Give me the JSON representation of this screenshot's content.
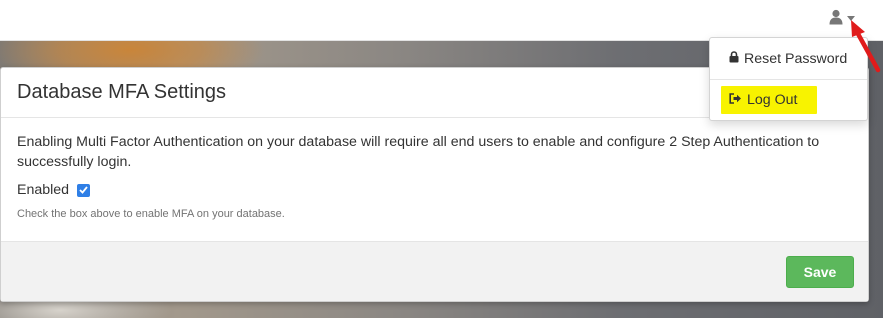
{
  "topbar": {
    "user_menu_icon": "user-icon",
    "caret_icon": "chevron-down-icon"
  },
  "dropdown": {
    "items": [
      {
        "label": "Reset Password",
        "icon": "lock-icon"
      },
      {
        "label": "Log Out",
        "icon": "sign-out-icon",
        "highlight_color": "#f8f300"
      }
    ]
  },
  "modal": {
    "title": "Database MFA Settings",
    "description": "Enabling Multi Factor Authentication on your database will require all end users to enable and configure 2 Step Authentication to successfully login.",
    "enabled_label": "Enabled",
    "enabled_checked": true,
    "help_text": "Check the box above to enable MFA on your database.",
    "save_label": "Save"
  },
  "annotation": {
    "arrow_color": "#e01b1b",
    "points_to": "user menu"
  },
  "colors": {
    "save_button": "#5cb85c",
    "checkbox": "#2f7fe6",
    "highlight": "#f8f300"
  }
}
